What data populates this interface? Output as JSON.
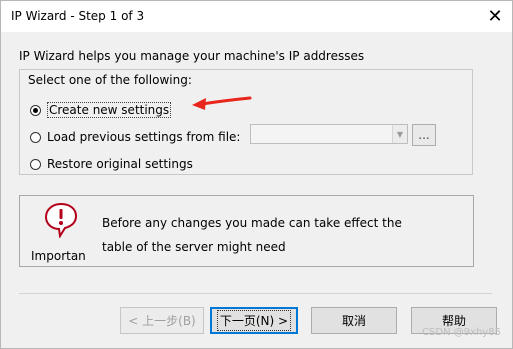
{
  "window": {
    "title": "IP Wizard - Step 1 of 3",
    "close_glyph": "✕"
  },
  "intro_text": "IP Wizard helps you manage your machine's IP addresses",
  "options": {
    "group_label": "Select one of the following:",
    "create_label": "Create new settings",
    "load_label": "Load previous settings from file:",
    "restore_label": "Restore original settings",
    "selected": "create",
    "file_combo_value": "",
    "browse_label": "..."
  },
  "note": {
    "icon": "warning-speech-bubble-icon",
    "important_label": "Importan",
    "line1": "Before any changes you made can take effect the",
    "line2": "table of the server might need"
  },
  "buttons": {
    "back": "< 上一步(B)",
    "next_main": "下一页(N)",
    "next_suffix": ">",
    "cancel": "取消",
    "help": "帮助"
  },
  "colors": {
    "annotation_arrow": "#e8261c",
    "focus_border": "#0078d7"
  },
  "watermarks": {
    "csdn": "CSDN @9xhy85"
  }
}
